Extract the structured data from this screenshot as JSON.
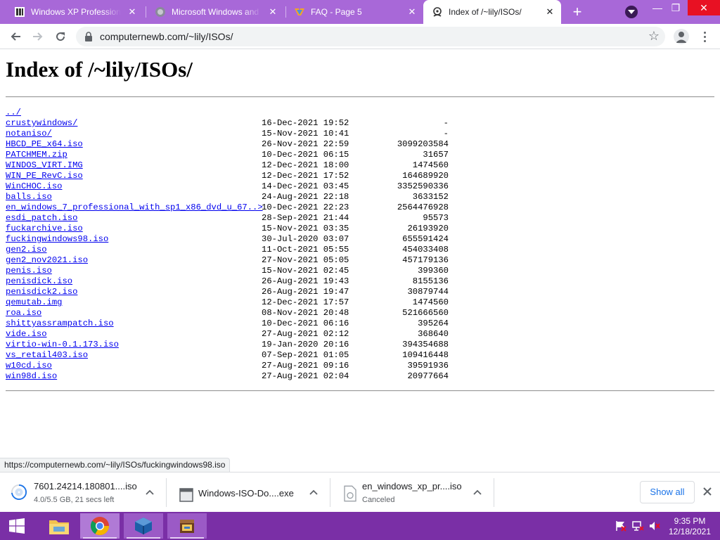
{
  "tabs": [
    {
      "title": "Windows XP Professional",
      "close": "✕"
    },
    {
      "title": "Microsoft Windows and MS-DOS",
      "close": "✕"
    },
    {
      "title": "FAQ - Page 5",
      "close": "✕"
    },
    {
      "title": "Index of /~lily/ISOs/",
      "close": "✕"
    }
  ],
  "new_tab": "+",
  "window_controls": {
    "minimize": "—",
    "restore": "❐",
    "close": "✕"
  },
  "omnibox": {
    "url": "computernewb.com/~lily/ISOs/"
  },
  "page": {
    "title": "Index of /~lily/ISOs/",
    "entries": [
      {
        "name": "../",
        "date": "",
        "size": ""
      },
      {
        "name": "crustywindows/",
        "date": "16-Dec-2021 19:52",
        "size": "-"
      },
      {
        "name": "notaniso/",
        "date": "15-Nov-2021 10:41",
        "size": "-"
      },
      {
        "name": "HBCD_PE_x64.iso",
        "date": "26-Nov-2021 22:59",
        "size": "3099203584"
      },
      {
        "name": "PATCHMEM.zip",
        "date": "10-Dec-2021 06:15",
        "size": "31657"
      },
      {
        "name": "WINDOS_VIRT.IMG",
        "date": "12-Dec-2021 18:00",
        "size": "1474560"
      },
      {
        "name": "WIN_PE_RevC.iso",
        "date": "12-Dec-2021 17:52",
        "size": "164689920"
      },
      {
        "name": "WinCHOC.iso",
        "date": "14-Dec-2021 03:45",
        "size": "3352590336"
      },
      {
        "name": "balls.iso",
        "date": "24-Aug-2021 22:18",
        "size": "3633152"
      },
      {
        "name": "en_windows_7_professional_with_sp1_x86_dvd_u_67..>",
        "date": "10-Dec-2021 22:23",
        "size": "2564476928"
      },
      {
        "name": "esdi_patch.iso",
        "date": "28-Sep-2021 21:44",
        "size": "95573"
      },
      {
        "name": "fuckarchive.iso",
        "date": "15-Nov-2021 03:35",
        "size": "26193920"
      },
      {
        "name": "fuckingwindows98.iso",
        "date": "30-Jul-2020 03:07",
        "size": "655591424"
      },
      {
        "name": "gen2.iso",
        "date": "11-Oct-2021 05:55",
        "size": "454033408"
      },
      {
        "name": "gen2_nov2021.iso",
        "date": "27-Nov-2021 05:05",
        "size": "457179136"
      },
      {
        "name": "penis.iso",
        "date": "15-Nov-2021 02:45",
        "size": "399360"
      },
      {
        "name": "penisdick.iso",
        "date": "26-Aug-2021 19:43",
        "size": "8155136"
      },
      {
        "name": "penisdick2.iso",
        "date": "26-Aug-2021 19:47",
        "size": "30879744"
      },
      {
        "name": "qemutab.img",
        "date": "12-Dec-2021 17:57",
        "size": "1474560"
      },
      {
        "name": "roa.iso",
        "date": "08-Nov-2021 20:48",
        "size": "521666560"
      },
      {
        "name": "shittyassrampatch.iso",
        "date": "10-Dec-2021 06:16",
        "size": "395264"
      },
      {
        "name": "vide.iso",
        "date": "27-Aug-2021 02:12",
        "size": "368640"
      },
      {
        "name": "virtio-win-0.1.173.iso",
        "date": "19-Jan-2020 20:16",
        "size": "394354688"
      },
      {
        "name": "vs_retail403.iso",
        "date": "07-Sep-2021 01:05",
        "size": "109416448"
      },
      {
        "name": "w10cd.iso",
        "date": "27-Aug-2021 09:16",
        "size": "39591936"
      },
      {
        "name": "win98d.iso",
        "date": "27-Aug-2021 02:04",
        "size": "20977664"
      }
    ]
  },
  "status_url": "https://computernewb.com/~lily/ISOs/fuckingwindows98.iso",
  "downloads": [
    {
      "name": "7601.24214.180801....iso",
      "status": "4.0/5.5 GB, 21 secs left",
      "progress": 0.73
    },
    {
      "name": "Windows-ISO-Do....exe",
      "status": ""
    },
    {
      "name": "en_windows_xp_pr....iso",
      "status": "Canceled"
    }
  ],
  "show_all": "Show all",
  "clock": {
    "time": "9:35 PM",
    "date": "12/18/2021"
  },
  "colors": {
    "tabstrip": "#a868d8",
    "taskbar": "#7a2fa6",
    "link": "#0000ee",
    "accent": "#1a73e8"
  }
}
